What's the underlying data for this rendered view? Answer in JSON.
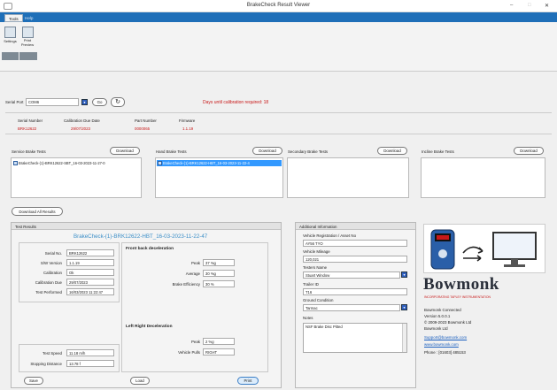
{
  "window": {
    "title": "BrakeCheck Result Viewer",
    "min": "–",
    "max": "□",
    "close": "✕"
  },
  "tabs": [
    {
      "label": "Tools"
    },
    {
      "label": "Help"
    }
  ],
  "ribbon": {
    "settings_label": "Settings",
    "print_label": "Print Preview"
  },
  "toolbar": {
    "serial_port_label": "Serial Port",
    "serial_port_value": "COM6",
    "go_label": "Go",
    "calibration_msg": "Days until calibration required: 18"
  },
  "device": {
    "headers": [
      "Serial Number",
      "Calibration Due Date",
      "Part Number",
      "Firmware"
    ],
    "values": [
      "BRK12622",
      "29/07/2023",
      "0000065",
      "1.1.19"
    ]
  },
  "tests": {
    "service": {
      "title": "Service Brake Tests",
      "download": "Download",
      "items": [
        "BrakeCheck-(1)-BRK12622-SBT_16-03-2023-11-27-0"
      ]
    },
    "hand": {
      "title": "Hand Brake Tests",
      "download": "Download",
      "items": [
        "BrakeCheck-(1)-BRK12622-HBT_16-03-2023-11-22-4"
      ]
    },
    "secondary": {
      "title": "Secondary Brake Tests",
      "download": "Download",
      "items": []
    },
    "incline": {
      "title": "Incline Brake Tests",
      "download": "Download",
      "items": []
    }
  },
  "download_all": "Download All Results",
  "results": {
    "title": "Test Results",
    "file_title": "BrakeCheck-(1)-BRK12622-HBT_16-03-2023-11-22-47",
    "serial_label": "Serial No.",
    "serial_value": "BRK12622",
    "sw_label": "S/W Version",
    "sw_value": "1.1.19",
    "cal_label": "Calibration",
    "cal_value": "Ok",
    "caldue_label": "Calibration Due",
    "caldue_value": "29/07/2023",
    "performed_label": "Test Performed",
    "performed_value": "16/03/2023 11:22:47",
    "speed_label": "Test Speed",
    "speed_value": "11.18 m/h",
    "stop_label": "Stopping Distance",
    "stop_value": "13.78 f",
    "front_title": "Front back deceleration",
    "peak_label": "Peak",
    "peak_value": "37 %g",
    "avg_label": "Average",
    "avg_value": "30 %g",
    "eff_label": "Brake Efficiency",
    "eff_value": "30 %",
    "lr_title": "Left Right Deceleration",
    "lr_peak_label": "Peak",
    "lr_peak_value": "2 %g",
    "pulls_label": "Vehicle Pulls",
    "pulls_value": "RIGHT",
    "save": "Save",
    "load": "Load",
    "print": "Print"
  },
  "additional": {
    "title": "Additional Information",
    "reg_label": "Vehicle Registration / Asset No",
    "reg_value": "AY56 TYO",
    "mileage_label": "Vehicle Mileage",
    "mileage_value": "120,021",
    "tester_label": "Testers Name",
    "tester_value": "Stuart Window",
    "trailer_label": "Trailer ID",
    "trailer_value": "T16",
    "ground_label": "Ground Condition",
    "ground_value": "Tarmac",
    "notes_label": "Notes",
    "notes_value": "NSF Brake Disc Pitted"
  },
  "brand": {
    "name": "Bowmonk",
    "tagline": "INCORPORATING TAPLEY INSTRUMENTATION",
    "lines": [
      "Bowmonk Connected",
      "Version 5.0.0.1",
      "© 2009-2023 Bowmonk Ltd",
      "Bowmonk Ltd"
    ],
    "email": "Support@bowmonk.com",
    "web": "www.bowmonk.com",
    "phone": "Phone : [01603] 485153",
    "colors": {
      "brand": "#2a2f3a",
      "accent": "#c81818",
      "link": "#1a5fbf"
    }
  }
}
